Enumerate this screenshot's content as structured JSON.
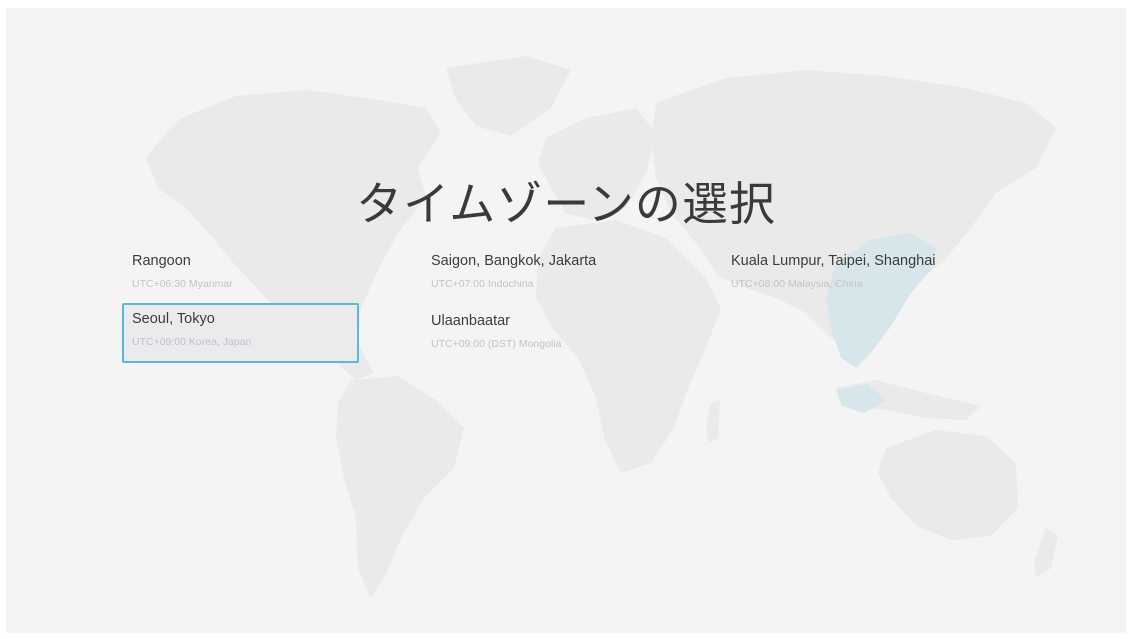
{
  "page": {
    "title": "タイムゾーンの選択"
  },
  "timezones": [
    {
      "name": "Rangoon",
      "desc": "UTC+06:30 Myanmar",
      "selected": false
    },
    {
      "name": "Saigon, Bangkok, Jakarta",
      "desc": "UTC+07:00 Indochina",
      "selected": false
    },
    {
      "name": "Kuala Lumpur, Taipei, Shanghai",
      "desc": "UTC+08:00 Malaysia, China",
      "selected": false
    },
    {
      "name": "Seoul, Tokyo",
      "desc": "UTC+09:00 Korea, Japan",
      "selected": true
    },
    {
      "name": "Ulaanbaatar",
      "desc": "UTC+09:00 (DST) Mongolia",
      "selected": false
    }
  ],
  "colors": {
    "background": "#f4f4f4",
    "continents": "#eaeaea",
    "highlight_region": "#d6e6ea",
    "selection_border": "#5bb8d8",
    "selection_fill": "#ebebee"
  }
}
